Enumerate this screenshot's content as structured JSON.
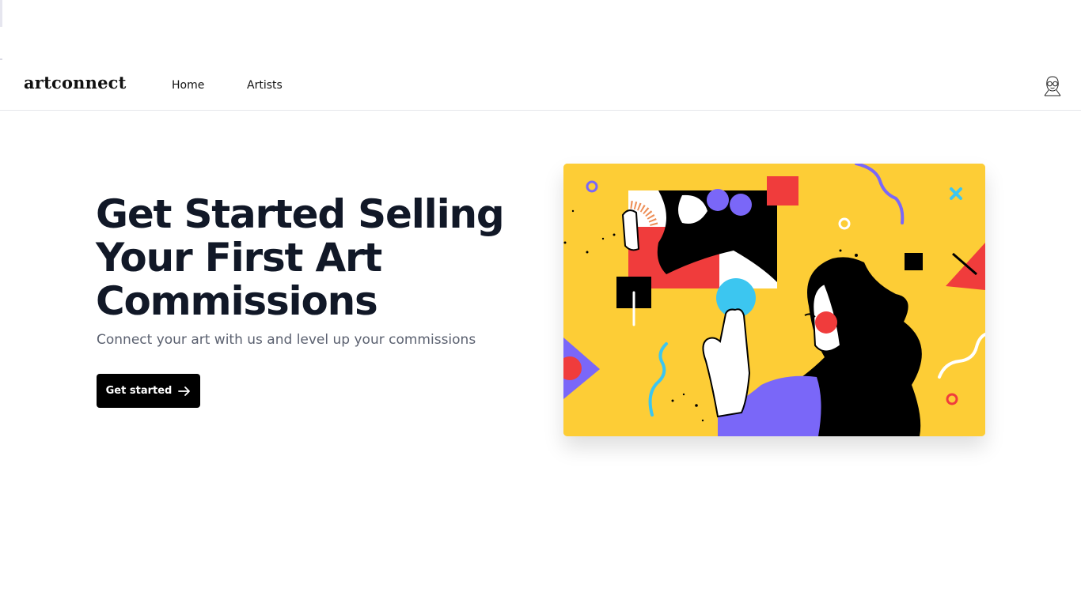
{
  "brand": {
    "name": "artconnect"
  },
  "nav": {
    "home": "Home",
    "artists": "Artists"
  },
  "hero": {
    "title": "Get Started Selling Your First Art Commissions",
    "subtitle": "Connect your art with us and level up your commissions",
    "cta_label": "Get started"
  },
  "icons": {
    "avatar": "user-avatar-icon",
    "cta_arrow": "arrow-right-icon"
  },
  "colors": {
    "primary": "#000000",
    "heading": "#111827",
    "muted": "#5b6170",
    "illustration_bg": "#fdcd36",
    "accent_red": "#f03c3c",
    "accent_purple": "#7a67f8",
    "accent_cyan": "#3cc6f0"
  }
}
